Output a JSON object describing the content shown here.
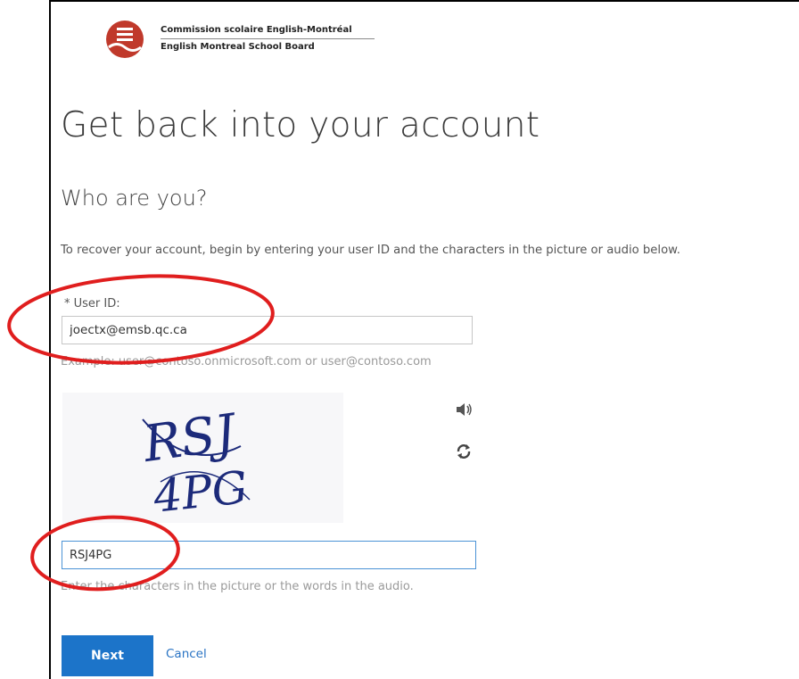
{
  "org": {
    "name_fr": "Commission scolaire English-Montréal",
    "name_en": "English Montreal School Board",
    "brand_color": "#c0392b"
  },
  "page": {
    "title": "Get back into your account",
    "subtitle": "Who are you?",
    "instructions": "To recover your account, begin by entering your user ID and the characters in the picture or audio below."
  },
  "user_id": {
    "label": "* User ID:",
    "value": "joectx@emsb.qc.ca",
    "hint": "Example: user@contoso.onmicrosoft.com or user@contoso.com"
  },
  "captcha": {
    "line1": "RSJ",
    "line2": "4PG",
    "audio_icon": "speaker-icon",
    "refresh_icon": "refresh-icon",
    "value": "RSJ4PG",
    "hint": "Enter the characters in the picture or the words in the audio."
  },
  "actions": {
    "next_label": "Next",
    "cancel_label": "Cancel",
    "primary_color": "#1c74c9"
  },
  "annotation_color": "#e01e1e"
}
